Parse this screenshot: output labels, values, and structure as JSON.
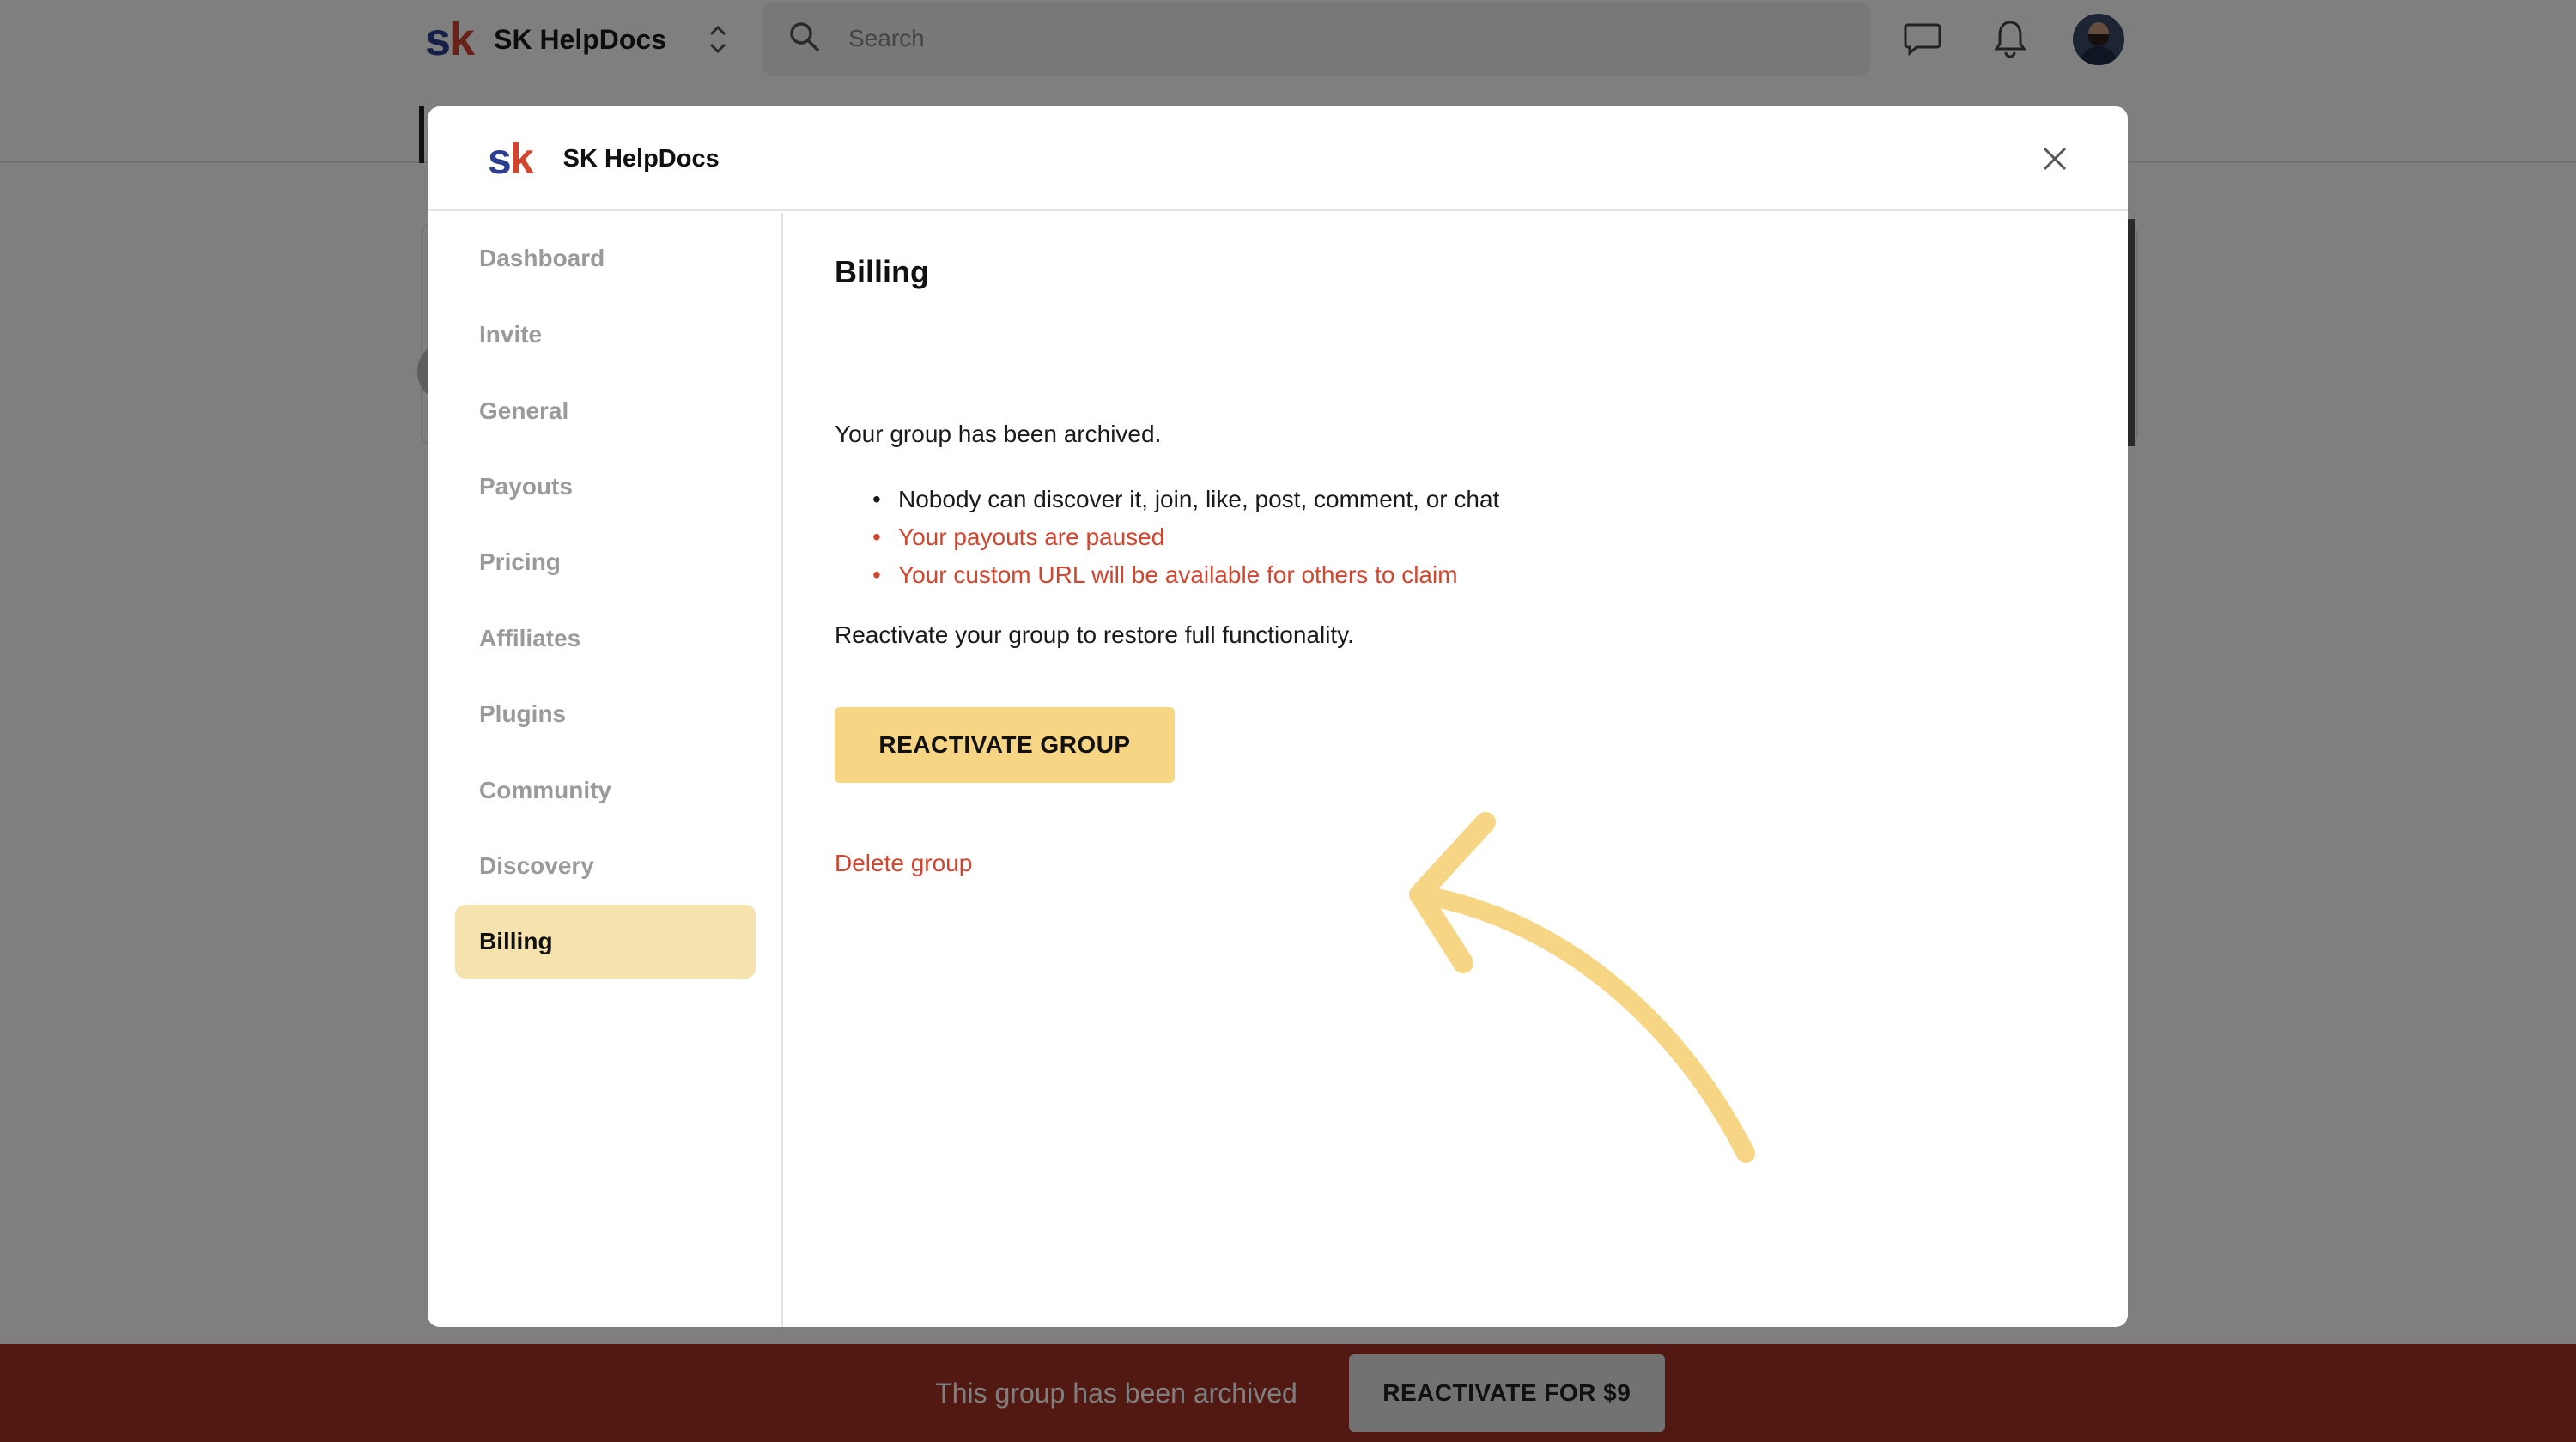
{
  "app": {
    "name": "SK HelpDocs",
    "logo_s": "s",
    "logo_k": "k",
    "switcher_icon": "chevron-up-down-icon"
  },
  "search": {
    "placeholder": "Search",
    "icon": "search-icon"
  },
  "header_icons": [
    "chat-icon",
    "bell-icon",
    "avatar"
  ],
  "modal": {
    "title": "SK HelpDocs",
    "close_icon": "close-icon",
    "nav": [
      {
        "label": "Dashboard",
        "active": false
      },
      {
        "label": "Invite",
        "active": false
      },
      {
        "label": "General",
        "active": false
      },
      {
        "label": "Payouts",
        "active": false
      },
      {
        "label": "Pricing",
        "active": false
      },
      {
        "label": "Affiliates",
        "active": false
      },
      {
        "label": "Plugins",
        "active": false
      },
      {
        "label": "Community",
        "active": false
      },
      {
        "label": "Discovery",
        "active": false
      },
      {
        "label": "Billing",
        "active": true
      }
    ],
    "content": {
      "heading": "Billing",
      "intro": "Your group has been archived.",
      "bullets": [
        {
          "text": "Nobody can discover it, join, like, post, comment, or chat",
          "tone": "dark"
        },
        {
          "text": "Your payouts are paused",
          "tone": "red"
        },
        {
          "text": "Your custom URL will be available for others to claim",
          "tone": "red"
        }
      ],
      "reactivate_hint": "Reactivate your group to restore full functionality.",
      "reactivate_button": "REACTIVATE GROUP",
      "delete_link": "Delete group",
      "annotation_arrow_color": "#f6d585"
    }
  },
  "banner": {
    "text": "This group has been archived",
    "button": "REACTIVATE FOR $9",
    "color": "#a33224"
  },
  "colors": {
    "accent": "#f6d585",
    "active_nav": "#f6e2ad",
    "danger": "#d2452e",
    "logo_blue": "#2c3e8f"
  }
}
